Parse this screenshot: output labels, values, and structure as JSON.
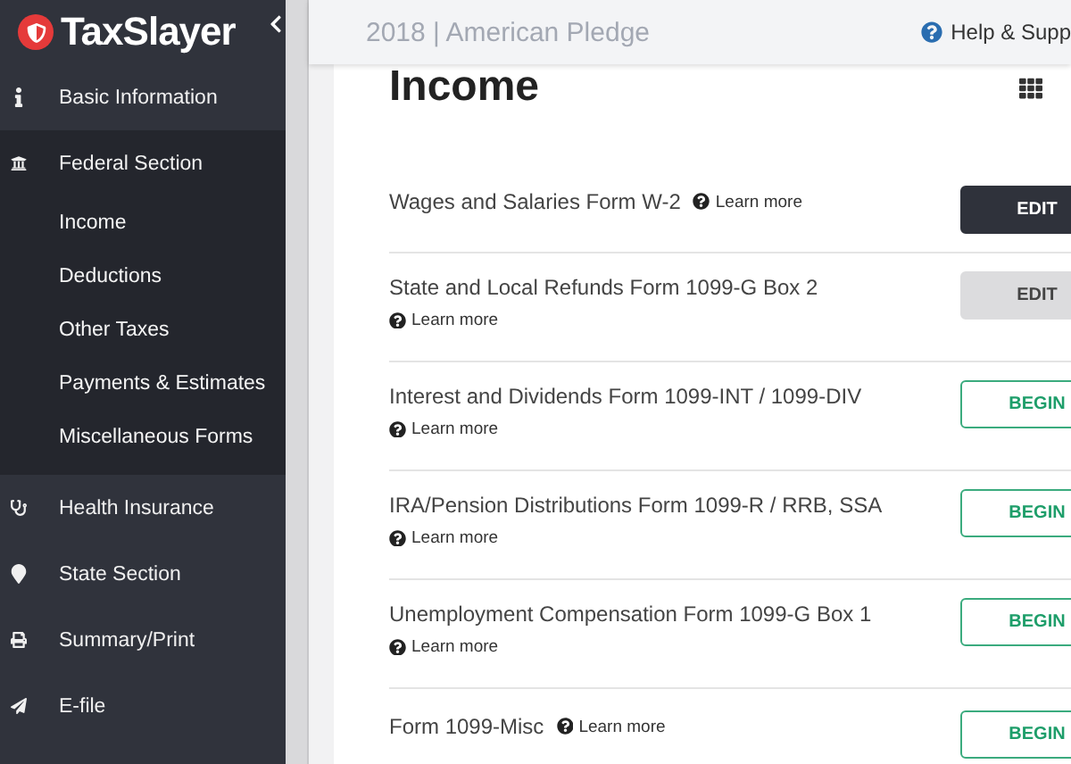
{
  "sidebar": {
    "logo": "TaxSlayer",
    "items": [
      {
        "label": "Basic Information",
        "expanded": false
      },
      {
        "label": "Federal Section",
        "expanded": true,
        "children": [
          {
            "label": "Income"
          },
          {
            "label": "Deductions"
          },
          {
            "label": "Other Taxes"
          },
          {
            "label": "Payments & Estimates"
          },
          {
            "label": "Miscellaneous Forms"
          }
        ]
      },
      {
        "label": "Health Insurance",
        "expanded": false
      },
      {
        "label": "State Section",
        "expanded": false
      },
      {
        "label": "Summary/Print",
        "expanded": false
      },
      {
        "label": "E-file",
        "expanded": false
      }
    ]
  },
  "header": {
    "title": "2018 | American Pledge",
    "help": "Help & Supp"
  },
  "page": {
    "title": "Income",
    "rows": [
      {
        "label": "Wages and Salaries Form W-2",
        "learn_more": "Learn more",
        "inline": true,
        "button": {
          "label": "EDIT",
          "kind": "dark"
        }
      },
      {
        "label": "State and Local Refunds Form 1099-G Box 2",
        "learn_more": "Learn more",
        "inline": false,
        "button": {
          "label": "EDIT",
          "kind": "grey"
        }
      },
      {
        "label": "Interest and Dividends Form 1099-INT / 1099-DIV",
        "learn_more": "Learn more",
        "inline": false,
        "button": {
          "label": "BEGIN",
          "kind": "outline"
        }
      },
      {
        "label": "IRA/Pension Distributions Form 1099-R / RRB, SSA",
        "learn_more": "Learn more",
        "inline": false,
        "button": {
          "label": "BEGIN",
          "kind": "outline"
        }
      },
      {
        "label": "Unemployment Compensation Form 1099-G Box 1",
        "learn_more": "Learn more",
        "inline": false,
        "button": {
          "label": "BEGIN",
          "kind": "outline"
        }
      },
      {
        "label": "Form 1099-Misc",
        "learn_more": "Learn more",
        "inline": true,
        "button": {
          "label": "BEGIN",
          "kind": "outline"
        }
      }
    ]
  }
}
